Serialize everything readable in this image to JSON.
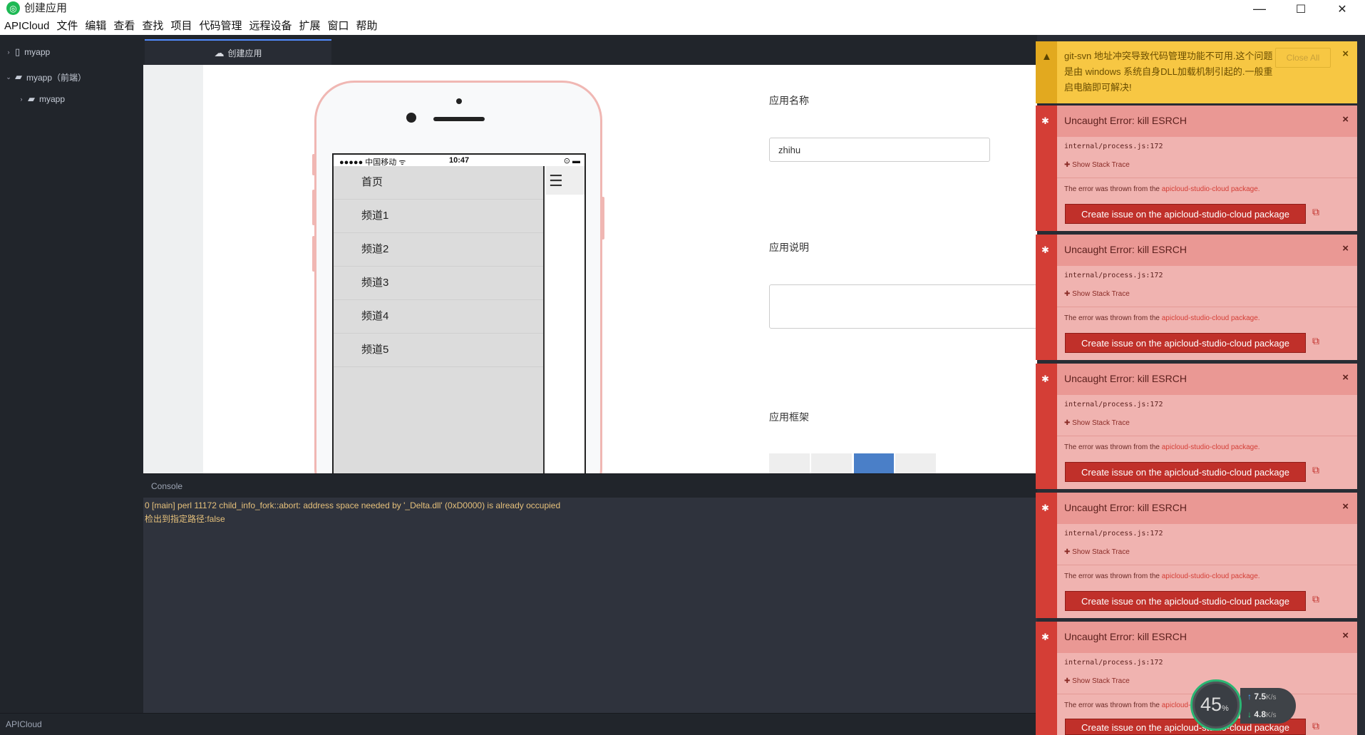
{
  "window": {
    "title": "创建应用",
    "minimize": "—",
    "maximize": "☐",
    "close": "✕"
  },
  "menu": [
    "APICloud",
    "文件",
    "编辑",
    "查看",
    "查找",
    "项目",
    "代码管理",
    "远程设备",
    "扩展",
    "窗口",
    "帮助"
  ],
  "tree": [
    {
      "label": "myapp",
      "arrow": "›",
      "icon": "device-icon"
    },
    {
      "label": "myapp（前端）",
      "arrow": "⌄",
      "icon": "folder-icon"
    },
    {
      "label": "myapp",
      "arrow": "›",
      "icon": "folder-icon"
    }
  ],
  "tab": {
    "label": "创建应用"
  },
  "phone": {
    "carrier": "●●●●● 中国移动 ᯤ",
    "time": "10:47",
    "battery": "⊙ ▬",
    "menu": [
      "首页",
      "频道1",
      "频道2",
      "频道3",
      "频道4",
      "频道5"
    ]
  },
  "form": {
    "name_label": "应用名称",
    "name_value": "zhihu",
    "desc_label": "应用说明",
    "desc_value": "",
    "frame_label": "应用框架"
  },
  "console": {
    "title": "Console",
    "lines": [
      "0 [main] perl 11172 child_info_fork::abort: address space needed by '_Delta.dll' (0xD0000) is already occupied",
      "检出到指定路径:false"
    ]
  },
  "statusbar": {
    "label": "APICloud"
  },
  "warning": {
    "message": "git-svn 地址冲突导致代码管理功能不可用.这个问题是由 windows 系统自身DLL加载机制引起的.一般重启电脑即可解决!",
    "close_all": "Close All"
  },
  "errors": [
    {
      "title": "Uncaught Error: kill ESRCH",
      "location": "internal/process.js:172",
      "trace": "Show Stack Trace",
      "thrown_prefix": "The error was thrown from the ",
      "package": "apicloud-studio-cloud package.",
      "issue": "Create issue on the apicloud-studio-cloud package"
    },
    {
      "title": "Uncaught Error: kill ESRCH",
      "location": "internal/process.js:172",
      "trace": "Show Stack Trace",
      "thrown_prefix": "The error was thrown from the ",
      "package": "apicloud-studio-cloud package.",
      "issue": "Create issue on the apicloud-studio-cloud package"
    },
    {
      "title": "Uncaught Error: kill ESRCH",
      "location": "internal/process.js:172",
      "trace": "Show Stack Trace",
      "thrown_prefix": "The error was thrown from the ",
      "package": "apicloud-studio-cloud package.",
      "issue": "Create issue on the apicloud-studio-cloud package"
    },
    {
      "title": "Uncaught Error: kill ESRCH",
      "location": "internal/process.js:172",
      "trace": "Show Stack Trace",
      "thrown_prefix": "The error was thrown from the ",
      "package": "apicloud-studio-cloud package.",
      "issue": "Create issue on the apicloud-studio-cloud package"
    },
    {
      "title": "Uncaught Error: kill ESRCH",
      "location": "internal/process.js:172",
      "trace": "Show Stack Trace",
      "thrown_prefix": "The error was thrown from the ",
      "package": "apicloud-studio-cloud package.",
      "issue": "Create issue on the apicloud-studio-cloud package"
    }
  ],
  "network": {
    "percent": "45",
    "percent_unit": "%",
    "up": "7.5",
    "down": "4.8",
    "unit": "K/s"
  },
  "colors": {
    "accent": "#528bff",
    "error": "#d43e36",
    "warning": "#f7c743",
    "selected_frame": "#4a7fc8"
  }
}
